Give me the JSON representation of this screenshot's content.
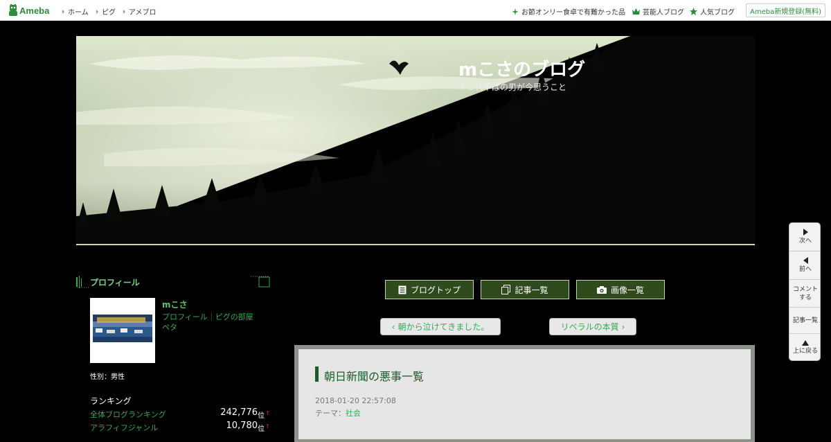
{
  "topbar": {
    "logo_text": "Ameba",
    "nav": [
      "ホーム",
      "ピグ",
      "アメブロ"
    ],
    "right_links": [
      "お節オンリー食卓で有難かった品",
      "芸能人ブログ",
      "人気ブログ"
    ],
    "register_label": "Ameba新規登録(無料)"
  },
  "header": {
    "title": "mこさのブログ",
    "description": "４０代半ばの男が今思うこと"
  },
  "sidebar": {
    "profile_heading": "プロフィール",
    "name": "mこさ",
    "profile_link": "プロフィール｜ピグの部屋",
    "profile_link2": "ペタ",
    "gender": "性別：男性",
    "ranking_title": "ランキング",
    "rankings": [
      {
        "label": "全体ブログランキング",
        "value": "242,776",
        "unit": "位",
        "arrow": "↑"
      },
      {
        "label": "アラフィフジャンル",
        "value": "10,780",
        "unit": "位",
        "arrow": "↑"
      }
    ]
  },
  "buttons": {
    "blog_top": "ブログトップ",
    "entry_list": "記事一覧",
    "image_list": "画像一覧"
  },
  "pager": {
    "prev": "朝から泣けてきました。",
    "next": "リベラルの本質"
  },
  "article": {
    "title": "朝日新聞の悪事一覧",
    "date": "2018-01-20 22:57:08",
    "theme_label": "テーマ：",
    "theme": "社会"
  },
  "floatnav": {
    "next": "次へ",
    "prev": "前へ",
    "comment1": "コメント",
    "comment2": "する",
    "entries": "記事一覧",
    "top": "上に戻る"
  },
  "colors": {
    "brand": "#2d8c3c",
    "link": "#3aa856",
    "button_bg": "#2f4a1c"
  }
}
